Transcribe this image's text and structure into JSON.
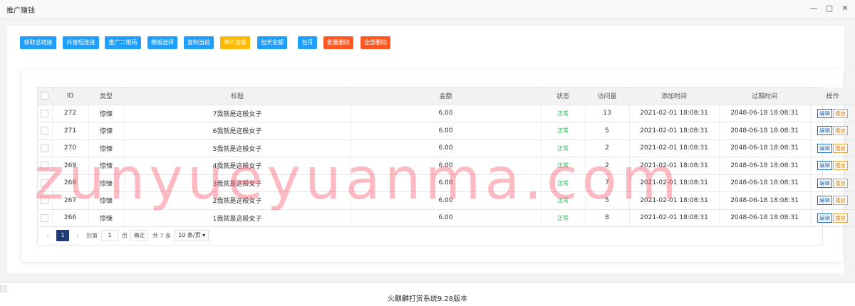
{
  "window": {
    "title": "推广赚钱",
    "controls": [
      "minimize-icon",
      "maximize-icon",
      "close-icon"
    ]
  },
  "toolbar": {
    "buttons": [
      {
        "label": "获取总链接",
        "color": "blue"
      },
      {
        "label": "抖音短连接",
        "color": "blue"
      },
      {
        "label": "推广二维码",
        "color": "blue"
      },
      {
        "label": "模板选择",
        "color": "blue"
      },
      {
        "label": "复制当前",
        "color": "blue"
      },
      {
        "label": "单片金额",
        "color": "yellow"
      },
      {
        "label": "包天金额",
        "color": "blue"
      },
      {
        "label": "包月",
        "color": "blue"
      },
      {
        "label": "批量删除",
        "color": "red"
      },
      {
        "label": "全部删除",
        "color": "red"
      }
    ]
  },
  "table": {
    "headers": [
      "ID",
      "类型",
      "标题",
      "金额",
      "状态",
      "访问量",
      "添加时间",
      "过期时间",
      "操作"
    ],
    "rows": [
      {
        "id": "272",
        "type": "惊悚",
        "title": "7我就是这般女子",
        "amount": "6.00",
        "status": "正常",
        "visits": "13",
        "added": "2021-02-01 18:08:31",
        "expires": "2048-06-18 18:08:31"
      },
      {
        "id": "271",
        "type": "惊悚",
        "title": "6我就是这般女子",
        "amount": "6.00",
        "status": "正常",
        "visits": "5",
        "added": "2021-02-01 18:08:31",
        "expires": "2048-06-18 18:08:31"
      },
      {
        "id": "270",
        "type": "惊悚",
        "title": "5我就是这般女子",
        "amount": "6.00",
        "status": "正常",
        "visits": "2",
        "added": "2021-02-01 18:08:31",
        "expires": "2048-06-18 18:08:31"
      },
      {
        "id": "269",
        "type": "惊悚",
        "title": "4我就是这般女子",
        "amount": "6.00",
        "status": "正常",
        "visits": "2",
        "added": "2021-02-01 18:08:31",
        "expires": "2048-06-18 18:08:31"
      },
      {
        "id": "268",
        "type": "惊悚",
        "title": "3我就是这般女子",
        "amount": "6.00",
        "status": "正常",
        "visits": "7",
        "added": "2021-02-01 18:08:31",
        "expires": "2048-06-18 18:08:31"
      },
      {
        "id": "267",
        "type": "惊悚",
        "title": "2我就是这般女子",
        "amount": "6.00",
        "status": "正常",
        "visits": "5",
        "added": "2021-02-01 18:08:31",
        "expires": "2048-06-18 18:08:31"
      },
      {
        "id": "266",
        "type": "惊悚",
        "title": "1我就是这般女子",
        "amount": "6.00",
        "status": "正常",
        "visits": "8",
        "added": "2021-02-01 18:08:31",
        "expires": "2048-06-18 18:08:31"
      }
    ],
    "actions": {
      "edit": "编辑",
      "play": "播放"
    }
  },
  "pager": {
    "current": "1",
    "goto_label": "到第",
    "goto_value": "1",
    "page_unit": "页",
    "confirm": "确定",
    "total": "共 7 条",
    "page_size": "10 条/页"
  },
  "watermark": "zunyueyuanma.com",
  "footer": {
    "text": "火麒麟打赏系统9.28版本"
  }
}
